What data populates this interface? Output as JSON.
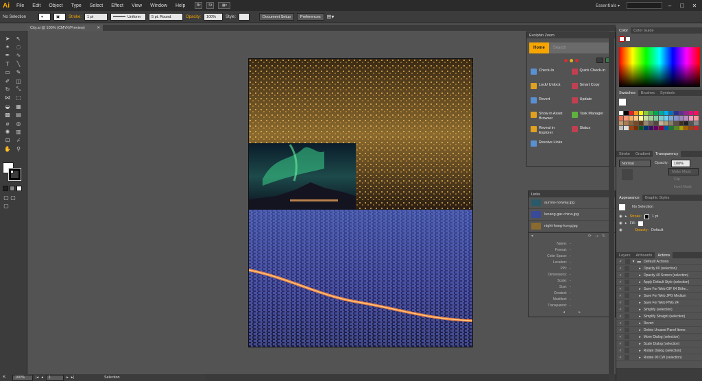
{
  "app": {
    "logo": "Ai",
    "workspace": "Essentials ▾"
  },
  "menu": [
    "File",
    "Edit",
    "Object",
    "Type",
    "Select",
    "Effect",
    "View",
    "Window",
    "Help"
  ],
  "menu_mini": [
    "Br",
    "St"
  ],
  "search_placeholder": "",
  "control_bar": {
    "selection": "No Selection",
    "stroke_label": "Stroke:",
    "stroke_weight": "1 pt",
    "profile": "Uniform",
    "brush": "5 pt. Round",
    "opacity_label": "Opacity:",
    "opacity_value": "100%",
    "style_label": "Style:",
    "document_setup": "Document Setup",
    "preferences": "Preferences"
  },
  "doc_tab": "City.ai @ 100% (CMYK/Preview)",
  "evolphin": {
    "title": "Evolphin Zoom",
    "home_tab": "Home",
    "search_tab": "Search",
    "actions": [
      {
        "label": "Check-In",
        "color": "#5a8fd0"
      },
      {
        "label": "Quick Check-In",
        "color": "#c04050"
      },
      {
        "label": "Lock/ Unlock",
        "color": "#e0a020"
      },
      {
        "label": "Smart Copy",
        "color": "#c04050"
      },
      {
        "label": "Revert",
        "color": "#5a8fd0"
      },
      {
        "label": "Update",
        "color": "#c04050"
      },
      {
        "label": "Show in Asset Browser",
        "color": "#e0a020"
      },
      {
        "label": "Task Manager",
        "color": "#60b040"
      },
      {
        "label": "Reveal in Explorer",
        "color": "#e0a020"
      },
      {
        "label": "Status",
        "color": "#c04050"
      },
      {
        "label": "Resolve Links",
        "color": "#5a8fd0"
      }
    ]
  },
  "links": {
    "title": "Links",
    "files": [
      "aurora-norway.jpg",
      "lunang-gar-china.jpg",
      "night-hong-kong.jpg"
    ],
    "info_labels": [
      "Name:",
      "Format:",
      "Color Space:",
      "Location:",
      "PPI:",
      "Dimensions:",
      "Scale:",
      "Size:",
      "Created:",
      "Modified:",
      "Transparent:"
    ],
    "info_values": [
      "-",
      "-",
      "-",
      "-",
      "-",
      "-",
      "-",
      "-",
      "-",
      "-",
      "-"
    ]
  },
  "color_panel": {
    "tabs": [
      "Color",
      "Color Guide"
    ]
  },
  "swatches_panel": {
    "tabs": [
      "Swatches",
      "Brushes",
      "Symbols"
    ]
  },
  "transparency_panel": {
    "tabs": [
      "Stroke",
      "Gradient",
      "Transparency"
    ],
    "mode": "Normal",
    "opacity_label": "Opacity:",
    "opacity_value": "100%",
    "buttons": [
      "Make Mask",
      "Clip",
      "Invert Mask"
    ]
  },
  "appearance_panel": {
    "tabs": [
      "Appearance",
      "Graphic Styles"
    ],
    "selection": "No Selection",
    "stroke_label": "Stroke:",
    "stroke_value": "1 pt",
    "fill_label": "Fill:",
    "opacity_label": "Opacity:",
    "opacity_value": "Default"
  },
  "actions_panel": {
    "tabs": [
      "Layers",
      "Artboards",
      "Actions"
    ],
    "set_name": "Default Actions",
    "items": [
      "Opacity 60 (selection)",
      "Opacity 40 Screen (selection)",
      "Apply Default Style (selection)",
      "Save For Web GIF 64 Dithe...",
      "Save For Web JPG Medium",
      "Save For Web PNG 24",
      "Simplify (selection)",
      "Simplify Straight (selection)",
      "Revert",
      "Delete Unused Panel Items",
      "Move Dialog (selection)",
      "Scale Dialog (selection)",
      "Rotate Dialog (selection)",
      "Rotate 90 CW (selection)"
    ]
  },
  "status_bar": {
    "zoom": "100%",
    "page": "1",
    "tool": "Selection"
  }
}
